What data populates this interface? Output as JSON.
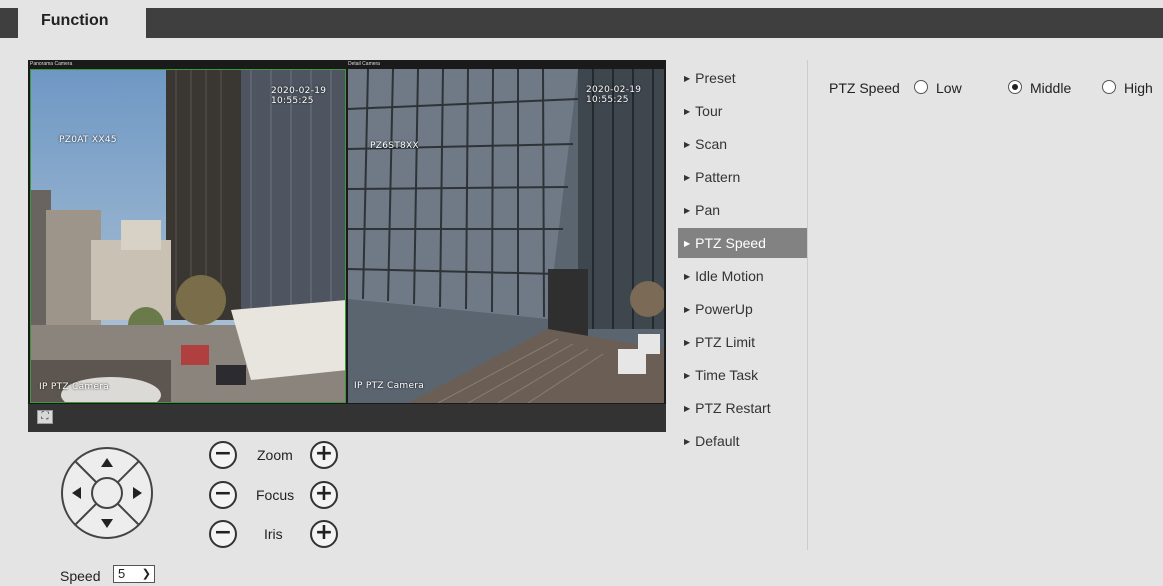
{
  "header": {
    "tab_label": "Function"
  },
  "video": {
    "left_camera_label": "Panorama Camera",
    "right_camera_label": "Detail Camera",
    "left_osd_timestamp": "2020-02-19 10:55:25",
    "left_osd_title": "PZ0AT XX45",
    "left_osd_footer": "IP PTZ Camera",
    "right_osd_timestamp": "2020-02-19 10:55:25",
    "right_osd_title": "PZ6ST8XX",
    "right_osd_footer": "IP PTZ Camera",
    "fullscreen_icon": "fullscreen-icon"
  },
  "ptz_controls": {
    "zoom_label": "Zoom",
    "focus_label": "Focus",
    "iris_label": "Iris",
    "minus_glyph": "−",
    "plus_glyph": "+",
    "speed_label": "Speed",
    "speed_value": "5"
  },
  "menu": {
    "items": [
      {
        "label": "Preset"
      },
      {
        "label": "Tour"
      },
      {
        "label": "Scan"
      },
      {
        "label": "Pattern"
      },
      {
        "label": "Pan"
      },
      {
        "label": "PTZ Speed"
      },
      {
        "label": "Idle Motion"
      },
      {
        "label": "PowerUp"
      },
      {
        "label": "PTZ Limit"
      },
      {
        "label": "Time Task"
      },
      {
        "label": "PTZ Restart"
      },
      {
        "label": "Default"
      }
    ],
    "active_index": 5
  },
  "panel": {
    "label": "PTZ Speed",
    "options": [
      {
        "label": "Low",
        "selected": false
      },
      {
        "label": "Middle",
        "selected": true
      },
      {
        "label": "High",
        "selected": false
      }
    ]
  }
}
